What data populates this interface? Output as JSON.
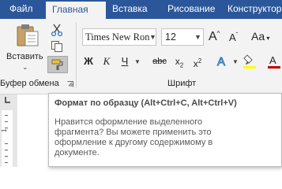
{
  "tabs": [
    {
      "label": "Файл",
      "active": false
    },
    {
      "label": "Главная",
      "active": true
    },
    {
      "label": "Вставка",
      "active": false
    },
    {
      "label": "Рисование",
      "active": false
    },
    {
      "label": "Конструктор",
      "active": false
    }
  ],
  "clipboard": {
    "paste_label": "Вставить",
    "group_label": "Буфер обмена",
    "icons": [
      "paste-icon",
      "cut-icon",
      "copy-icon",
      "format-painter-icon",
      "dialog-launcher-icon"
    ]
  },
  "font": {
    "name_value": "Times New Ron",
    "size_value": "12",
    "group_label": "Шрифт",
    "bold_label": "Ж",
    "italic_label": "К",
    "underline_label": "Ч",
    "strike_label": "abc",
    "sub_label": "x",
    "sub_mark": "2",
    "sup_label": "x",
    "sup_mark": "2",
    "grow_label": "A",
    "shrink_label": "A",
    "case_label": "Aa",
    "icons": [
      "increase-font-icon",
      "decrease-font-icon",
      "change-case-icon",
      "text-effects-icon",
      "highlight-icon",
      "font-color-icon"
    ]
  },
  "ruler": {
    "number": "1"
  },
  "tooltip": {
    "title": "Формат по образцу (Alt+Ctrl+C, Alt+Ctrl+V)",
    "body": "Нравится оформление выделенного фрагмента? Вы можете применить это оформление к другому содержимому в документе."
  },
  "colors": {
    "tab_bar": "#2b579a",
    "ribbon": "#f3f3f3",
    "font_color_accent": "#c00000",
    "highlight_accent": "#ffff00",
    "effects_accent": "#2e75b6"
  }
}
